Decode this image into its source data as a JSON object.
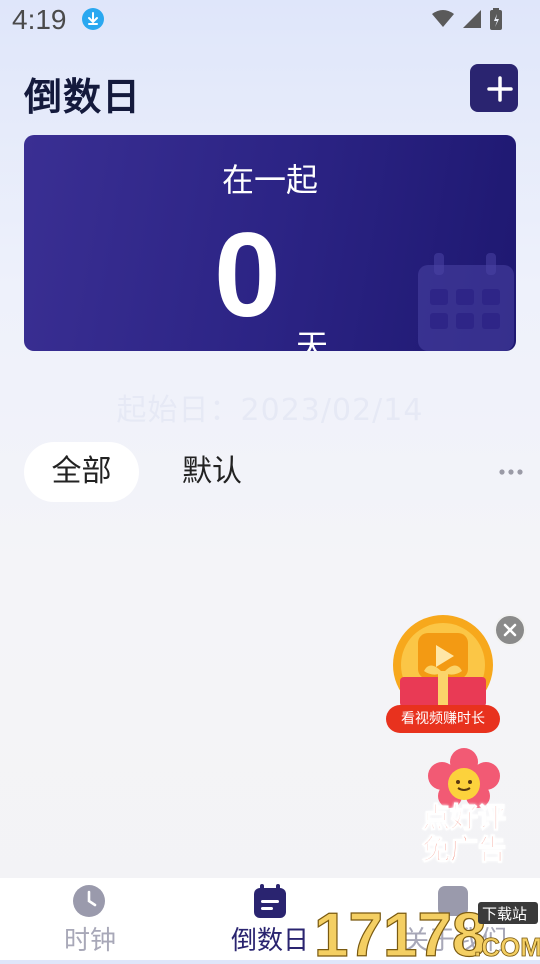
{
  "status_bar": {
    "time": "4:19"
  },
  "header": {
    "title": "倒数日"
  },
  "hero": {
    "title": "在一起",
    "count": "0",
    "unit": "天"
  },
  "start_date": "起始日：2023/02/14",
  "filter_tabs": [
    {
      "label": "全部",
      "active": true
    },
    {
      "label": "默认",
      "active": false
    }
  ],
  "ads": {
    "video_label": "看视频赚时长",
    "review_line1": "点好评",
    "review_line2": "免广告"
  },
  "bottom_nav": [
    {
      "label": "时钟",
      "icon": "clock-icon",
      "active": false
    },
    {
      "label": "倒数日",
      "icon": "calendar-icon",
      "active": true
    },
    {
      "label": "关于我们",
      "icon": "info-icon",
      "active": false
    }
  ],
  "watermark": {
    "brand": "17178",
    "top_text": "下载站",
    "suffix": ".COM"
  },
  "colors": {
    "accent": "#2a2470",
    "card": "#2e2587",
    "inactive": "#a8a8b8",
    "ad_red": "#e8321e"
  }
}
